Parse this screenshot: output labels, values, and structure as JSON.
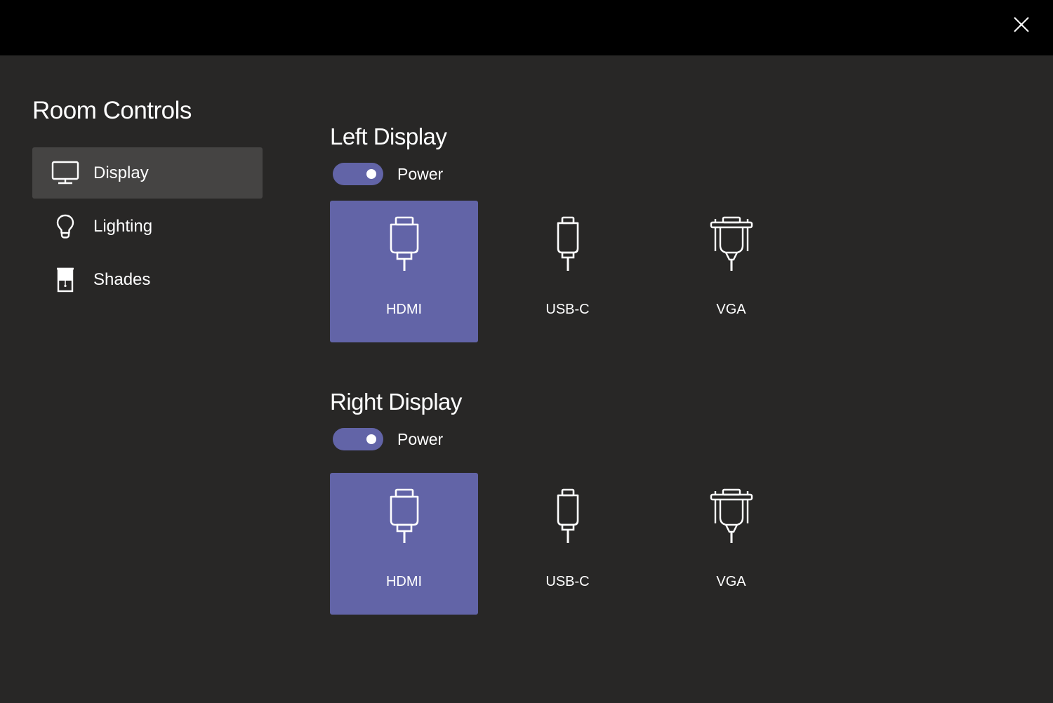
{
  "window": {
    "close_icon": "close-icon"
  },
  "sidebar": {
    "title": "Room Controls",
    "items": [
      {
        "label": "Display",
        "icon": "monitor-icon",
        "selected": true
      },
      {
        "label": "Lighting",
        "icon": "lightbulb-icon",
        "selected": false
      },
      {
        "label": "Shades",
        "icon": "shades-icon",
        "selected": false
      }
    ]
  },
  "displays": [
    {
      "title": "Left Display",
      "power_label": "Power",
      "power_on": true,
      "sources": [
        {
          "label": "HDMI",
          "icon": "hdmi-icon",
          "selected": true
        },
        {
          "label": "USB-C",
          "icon": "usb-c-icon",
          "selected": false
        },
        {
          "label": "VGA",
          "icon": "vga-icon",
          "selected": false
        }
      ]
    },
    {
      "title": "Right Display",
      "power_label": "Power",
      "power_on": true,
      "sources": [
        {
          "label": "HDMI",
          "icon": "hdmi-icon",
          "selected": true
        },
        {
          "label": "USB-C",
          "icon": "usb-c-icon",
          "selected": false
        },
        {
          "label": "VGA",
          "icon": "vga-icon",
          "selected": false
        }
      ]
    }
  ],
  "colors": {
    "accent": "#6264a7",
    "background": "#282726",
    "topbar": "#000000",
    "nav_selected": "#454443"
  }
}
